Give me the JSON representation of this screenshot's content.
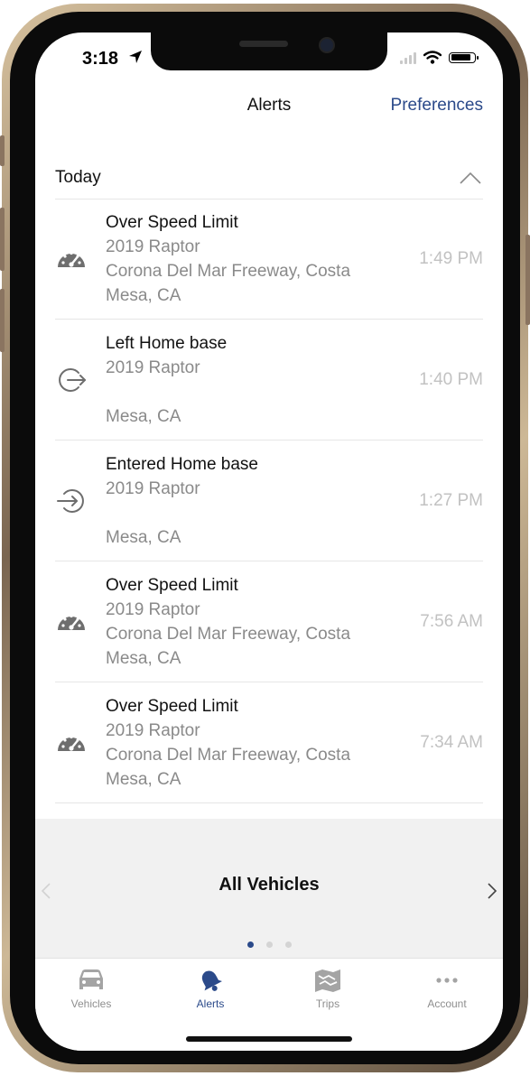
{
  "status_bar": {
    "time": "3:18"
  },
  "nav": {
    "title": "Alerts",
    "preferences": "Preferences"
  },
  "section": {
    "title": "Today"
  },
  "alerts": [
    {
      "icon": "speedometer-icon",
      "title": "Over Speed Limit",
      "vehicle": "2019 Raptor",
      "location_line1": "Corona Del Mar Freeway, Costa",
      "location_line2": "Mesa, CA",
      "time": "1:49 PM"
    },
    {
      "icon": "exit-geofence-icon",
      "title": "Left Home base",
      "vehicle": "2019 Raptor",
      "location_line1": "",
      "location_line2": "Mesa, CA",
      "time": "1:40 PM"
    },
    {
      "icon": "enter-geofence-icon",
      "title": "Entered Home base",
      "vehicle": "2019 Raptor",
      "location_line1": "",
      "location_line2": "Mesa, CA",
      "time": "1:27 PM"
    },
    {
      "icon": "speedometer-icon",
      "title": "Over Speed Limit",
      "vehicle": "2019 Raptor",
      "location_line1": "Corona Del Mar Freeway, Costa",
      "location_line2": "Mesa, CA",
      "time": "7:56 AM"
    },
    {
      "icon": "speedometer-icon",
      "title": "Over Speed Limit",
      "vehicle": "2019 Raptor",
      "location_line1": "Corona Del Mar Freeway, Costa",
      "location_line2": "Mesa, CA",
      "time": "7:34 AM"
    }
  ],
  "vehicle_selector": {
    "label": "All Vehicles",
    "current_page": 1,
    "page_count": 3
  },
  "tabs": [
    {
      "label": "Vehicles",
      "icon": "car-icon",
      "active": false
    },
    {
      "label": "Alerts",
      "icon": "bell-icon",
      "active": true
    },
    {
      "label": "Trips",
      "icon": "map-icon",
      "active": false
    },
    {
      "label": "Account",
      "icon": "more-dots-icon",
      "active": false
    }
  ],
  "colors": {
    "accent": "#2b4a8a",
    "text": "#111111",
    "secondary_text": "#8a8a8a",
    "time_text": "#c2c2c2",
    "panel_bg": "#f1f1f1"
  }
}
